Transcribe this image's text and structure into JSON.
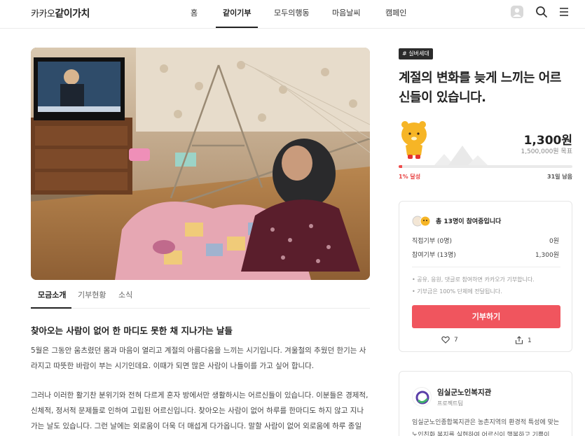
{
  "header": {
    "logo_prefix": "카카오",
    "logo_bold": "같이가치",
    "nav": [
      {
        "label": "홈"
      },
      {
        "label": "같이기부"
      },
      {
        "label": "모두의행동"
      },
      {
        "label": "마음날씨"
      },
      {
        "label": "캠페인"
      }
    ],
    "icons": [
      "avatar-icon",
      "search-icon",
      "menu-icon"
    ]
  },
  "tabs": [
    {
      "label": "모금소개"
    },
    {
      "label": "기부현황"
    },
    {
      "label": "소식"
    }
  ],
  "article": {
    "title": "찾아오는 사람이 없어 한 마디도 못한 채 지나가는 날들",
    "para1": "5월은 그동안 움츠렸던 몸과 마음이 열리고 계절의 아름다움을 느끼는 시기입니다. 겨울철의 추웠던 한기는 사라지고 따뜻한 바람이 부는 시기인데요. 이때가 되면 많은 사람이 나들이를 가고 싶어 합니다.",
    "para2": "그러나 이러한 활기찬 분위기와 전혀 다르게 혼자 방에서만 생활하시는 어르신들이 있습니다. 이분들은 경제적, 신체적, 정서적 문제들로 인하여 고립된 어르신입니다. 찾아오는 사람이 없어 하루를 한마디도 하지 않고 지나가는 날도 있습니다. 그런 날에는 외로움이 더욱 더 매섭게 다가옵니다. 말할 사람이 없어 외로움에 하루 종일 텔레비전만 보고 계십니다."
  },
  "campaign": {
    "tag": "# 실버세대",
    "title": "계절의 변화를 늦게 느끼는 어르신들이 있습니다.",
    "amount": "1,300원",
    "goal": "1,500,000원 목표",
    "progress_label": "1% 달성",
    "progress_fraction": 0.01,
    "days_left": "31일 남음"
  },
  "donation": {
    "participants": "총 13명이 참여중입니다",
    "direct_label": "직접기부 (0명)",
    "direct_value": "0원",
    "join_label": "참여기부 (13명)",
    "join_value": "1,300원",
    "note1": "• 공유, 응원, 댓글로 참여하면 카카오가 기부합니다.",
    "note2": "• 기부금은 100% 단체에 전달됩니다.",
    "button": "기부하기",
    "likes": "7",
    "shares": "1"
  },
  "org": {
    "name": "임실군노인복지관",
    "team": "프로젝트팀",
    "desc": "임실군노인종합복지관은 농촌지역의 환경적 특성에 맞는 노인친화 복지를 실현하여 어르신이 행복하고 기쁨이"
  },
  "colors": {
    "accent": "#f0555e",
    "progress": "#f04b4b",
    "text": "#222222"
  }
}
